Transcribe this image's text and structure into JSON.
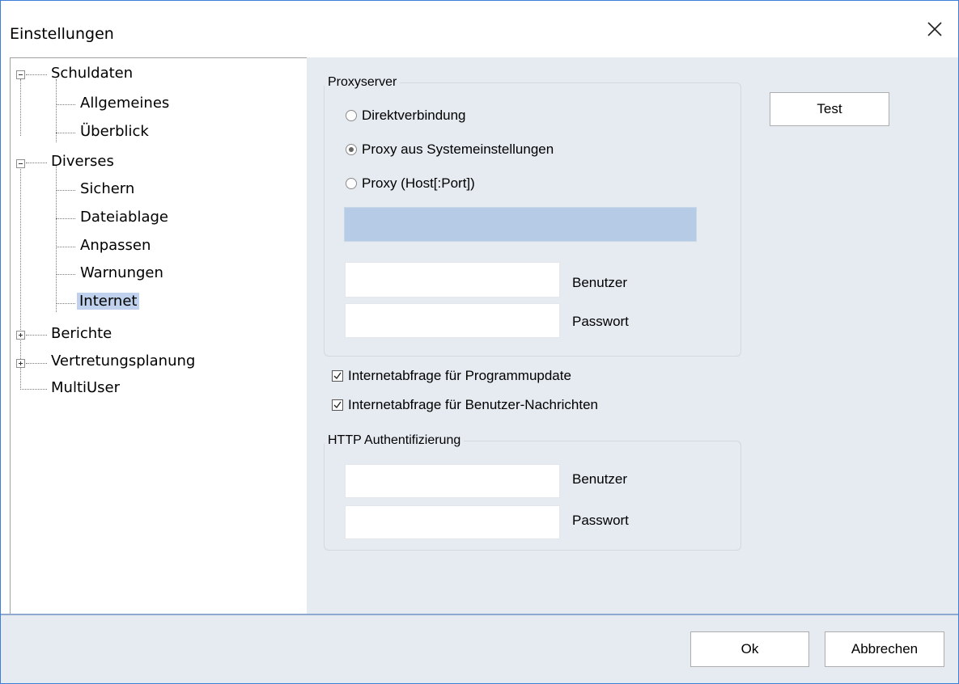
{
  "window": {
    "title": "Einstellungen"
  },
  "tree": {
    "items": [
      {
        "label": "Schuldaten"
      },
      {
        "label": "Allgemeines"
      },
      {
        "label": "Überblick"
      },
      {
        "label": "Diverses"
      },
      {
        "label": "Sichern"
      },
      {
        "label": "Dateiablage"
      },
      {
        "label": "Anpassen"
      },
      {
        "label": "Warnungen"
      },
      {
        "label": "Internet",
        "selected": true
      },
      {
        "label": "Berichte"
      },
      {
        "label": "Vertretungsplanung"
      },
      {
        "label": "MultiUser"
      }
    ]
  },
  "proxy": {
    "group_label": "Proxyserver",
    "options": [
      "Direktverbindung",
      "Proxy aus Systemeinstellungen",
      "Proxy (Host[:Port])"
    ],
    "selected_option": "Proxy aus Systemeinstellungen",
    "host_value": "",
    "user_label": "Benutzer",
    "user_value": "",
    "password_label": "Passwort",
    "password_value": ""
  },
  "test_button": "Test",
  "checks": [
    {
      "label": "Internetabfrage für Programmupdate",
      "checked": true
    },
    {
      "label": "Internetabfrage für Benutzer-Nachrichten",
      "checked": true
    }
  ],
  "http_auth": {
    "group_label": "HTTP Authentifizierung",
    "user_label": "Benutzer",
    "user_value": "",
    "password_label": "Passwort",
    "password_value": ""
  },
  "footer": {
    "ok_label": "Ok",
    "cancel_label": "Abbrechen"
  }
}
